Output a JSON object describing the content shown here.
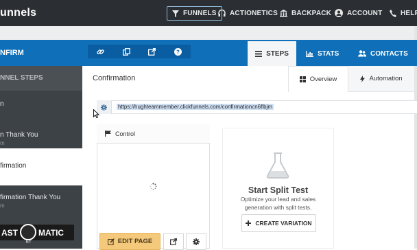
{
  "topnav": {
    "brand": "unnels",
    "items": [
      {
        "label": "FUNNELS",
        "icon": "filter-icon"
      },
      {
        "label": "ACTIONETICS",
        "icon": "headset-icon"
      },
      {
        "label": "BACKPACK",
        "icon": "bank-icon"
      },
      {
        "label": "ACCOUNT",
        "icon": "user-circle-icon"
      },
      {
        "label": "HELP",
        "icon": "phone-icon"
      }
    ]
  },
  "funnel_header": {
    "name": "NFIRM",
    "tabs": [
      {
        "label": "STEPS",
        "icon": "list-icon",
        "active": true
      },
      {
        "label": "STATS",
        "icon": "bar-chart-icon"
      },
      {
        "label": "CONTACTS",
        "icon": "users-icon"
      }
    ]
  },
  "sidebar": {
    "header": "NNEL STEPS",
    "items": [
      {
        "label": "n",
        "sub": ""
      },
      {
        "label": "n Thank You",
        "sub": "m"
      },
      {
        "label": "firmation",
        "sub": "",
        "active": true
      },
      {
        "label": "firmation Thank You",
        "sub": "m"
      }
    ]
  },
  "main": {
    "title": "Confirmation",
    "tabs": [
      {
        "label": "Overview",
        "icon": "grid-icon",
        "active": true
      },
      {
        "label": "Automation",
        "icon": "bolt-icon"
      }
    ],
    "url": "https://hughteammember.clickfunnels.com/confirmationcn6flbjm",
    "control_label": "Control",
    "edit_page_label": "EDIT PAGE",
    "split_test": {
      "title": "Start Split Test",
      "description": "Optimize your lead and sales generation with split tests.",
      "button_label": "CREATE VARIATION"
    }
  },
  "overlay": {
    "text_left": "AST",
    "text_right": "MATIC",
    "small_text": "ET"
  },
  "colors": {
    "topnav_bg": "#2b2f33",
    "bluebar_bg": "#0f6fb8",
    "sidebar_bg": "#3d4246",
    "edit_button": "#f5c97b"
  }
}
